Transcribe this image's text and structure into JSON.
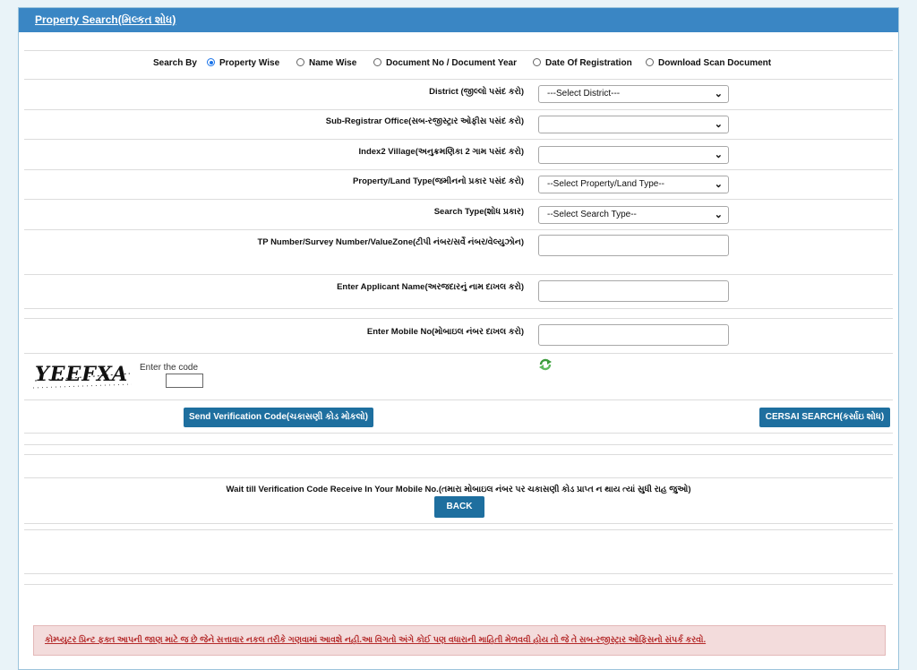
{
  "panel": {
    "title": "Property Search(મિલ્કત શોધ)"
  },
  "search_by": {
    "label": "Search By",
    "options": [
      "Property Wise",
      "Name Wise",
      "Document No / Document Year",
      "Date Of Registration",
      "Download Scan Document"
    ],
    "selected": "Property Wise"
  },
  "form": {
    "district_label": "District (જીલ્લો પસંદ કરો)",
    "district_value": "---Select District---",
    "subreg_label": "Sub-Registrar Office(સબ-રજીસ્ટ્રાર ઓફીસ પસંદ કરો)",
    "subreg_value": "",
    "village_label": "Index2 Village(અનુક્રમણિકા 2 ગામ પસંદ કરો)",
    "village_value": "",
    "property_label": "Property/Land Type(જમીનનો પ્રકાર પસંદ કરો)",
    "property_value": "--Select Property/Land Type--",
    "searchtype_label": "Search Type(શોધ પ્રકાર)",
    "searchtype_value": "--Select Search Type--",
    "tp_label": "TP Number/Survey Number/ValueZone(ટીપી નંબર/સર્વે નંબર/વેલ્યુઝોન)",
    "applicant_label": "Enter Applicant Name(અરજદારનું નામ દાખલ કરો)",
    "mobile_label": "Enter Mobile No(મોબાઇલ નંબર દાખલ કરો)"
  },
  "captcha": {
    "image_text": "YEEFXA",
    "enter_label": "Enter the code"
  },
  "buttons": {
    "send_code": "Send Verification Code(ચકાસણી કોડ મોકલો)",
    "cersai": "CERSAI SEARCH(કર્સાઇ શોધ)",
    "back": "BACK"
  },
  "wait_message": "Wait till Verification Code Receive In Your Mobile No.(તમારા મોબાઇલ નંબર પર ચકાસણી કોડ પ્રાપ્ત ન થાય ત્યાં સુધી રાહ જુઓ)",
  "disclaimer": "કોમ્પ્યુટર પ્રિન્ટ ફક્ત આપની જાણ માટે જ છે જેને સત્તાવાર નકલ તરીકે ગણવામાં આવશે નહી.આ વિગતો અંગે કોઈ પણ વધારાની માહિતી મેળવવી હોય તો જે તે સબ-રજીસ્ટ્રાર ઓફિસનો સંપર્ક કરવો."
}
